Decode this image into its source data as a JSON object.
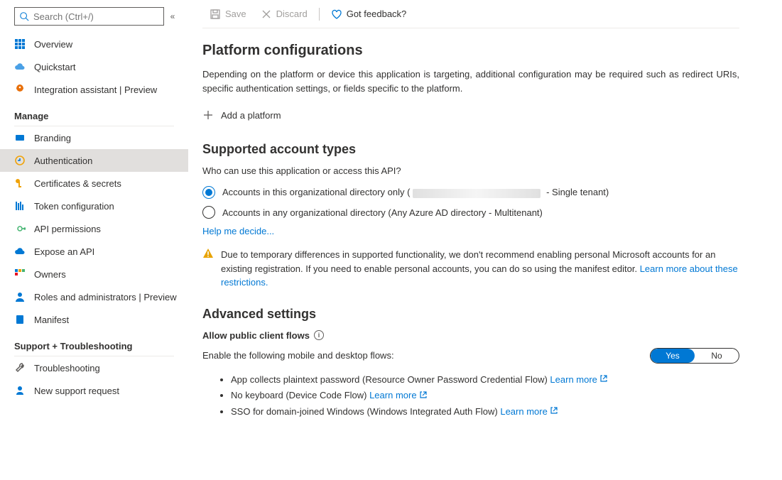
{
  "search": {
    "placeholder": "Search (Ctrl+/)"
  },
  "nav": {
    "items": [
      {
        "key": "overview",
        "label": "Overview"
      },
      {
        "key": "quickstart",
        "label": "Quickstart"
      },
      {
        "key": "integration",
        "label": "Integration assistant | Preview"
      }
    ],
    "manage_label": "Manage",
    "manage": [
      {
        "key": "branding",
        "label": "Branding"
      },
      {
        "key": "authentication",
        "label": "Authentication"
      },
      {
        "key": "certificates",
        "label": "Certificates & secrets"
      },
      {
        "key": "tokenconfig",
        "label": "Token configuration"
      },
      {
        "key": "apiperm",
        "label": "API permissions"
      },
      {
        "key": "expose",
        "label": "Expose an API"
      },
      {
        "key": "owners",
        "label": "Owners"
      },
      {
        "key": "roles",
        "label": "Roles and administrators | Preview"
      },
      {
        "key": "manifest",
        "label": "Manifest"
      }
    ],
    "support_label": "Support + Troubleshooting",
    "support": [
      {
        "key": "troubleshooting",
        "label": "Troubleshooting"
      },
      {
        "key": "newsupport",
        "label": "New support request"
      }
    ]
  },
  "toolbar": {
    "save": "Save",
    "discard": "Discard",
    "feedback": "Got feedback?"
  },
  "platform": {
    "heading": "Platform configurations",
    "description": "Depending on the platform or device this application is targeting, additional configuration may be required such as redirect URIs, specific authentication settings, or fields specific to the platform.",
    "add": "Add a platform"
  },
  "account": {
    "heading": "Supported account types",
    "question": "Who can use this application or access this API?",
    "opt1_prefix": "Accounts in this organizational directory only (",
    "opt1_suffix": " - Single tenant)",
    "opt2": "Accounts in any organizational directory (Any Azure AD directory - Multitenant)",
    "help": "Help me decide...",
    "warning_text": "Due to temporary differences in supported functionality, we don't recommend enabling personal Microsoft accounts for an existing registration. If you need to enable personal accounts, you can do so using the manifest editor. ",
    "warning_link": "Learn more about these restrictions."
  },
  "advanced": {
    "heading": "Advanced settings",
    "allow_label": "Allow public client flows",
    "enable_text": "Enable the following mobile and desktop flows:",
    "toggle_yes": "Yes",
    "toggle_no": "No",
    "flows": [
      {
        "text": "App collects plaintext password (Resource Owner Password Credential Flow) ",
        "learn": "Learn more"
      },
      {
        "text": "No keyboard (Device Code Flow) ",
        "learn": "Learn more"
      },
      {
        "text": "SSO for domain-joined Windows (Windows Integrated Auth Flow) ",
        "learn": "Learn more"
      }
    ]
  }
}
